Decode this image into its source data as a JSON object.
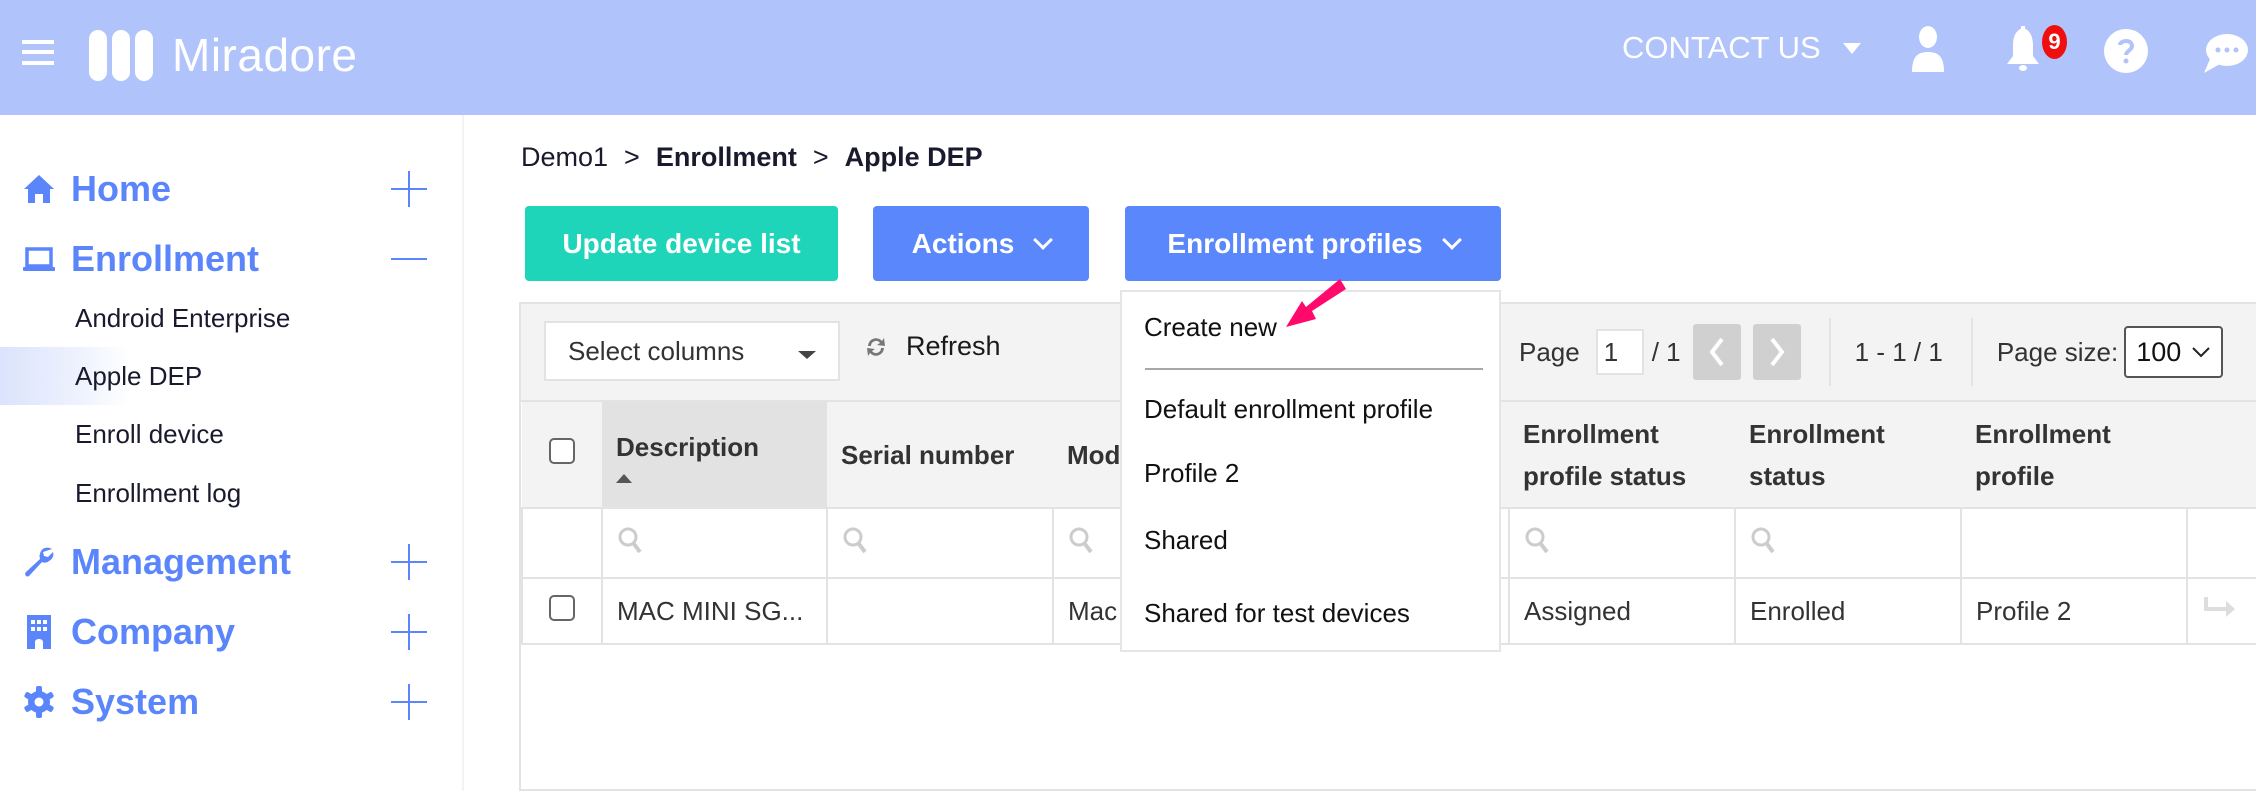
{
  "app": {
    "brand": "Miradore",
    "contact_label": "CONTACT US",
    "notification_count": "9",
    "colors": {
      "topbar": "#b0c3fa",
      "accent": "#5a85fb",
      "primary_button": "#5a87fb",
      "success_button": "#1ed5b9",
      "badge": "#ef0f0f",
      "annotation_arrow": "#ff0a6c"
    },
    "icons": {
      "menu": "hamburger-icon",
      "user": "user-icon",
      "notifications": "bell-icon",
      "help": "question-icon",
      "chat": "chat-bubble-icon"
    }
  },
  "sidebar": {
    "items": [
      {
        "label": "Home",
        "icon": "home-icon",
        "toggle": "+"
      },
      {
        "label": "Enrollment",
        "icon": "laptop-icon",
        "toggle": "-",
        "expanded": true,
        "children": [
          {
            "label": "Android Enterprise"
          },
          {
            "label": "Apple DEP",
            "active": true
          },
          {
            "label": "Enroll device"
          },
          {
            "label": "Enrollment log"
          }
        ]
      },
      {
        "label": "Management",
        "icon": "wrench-icon",
        "toggle": "+"
      },
      {
        "label": "Company",
        "icon": "building-icon",
        "toggle": "+"
      },
      {
        "label": "System",
        "icon": "gear-icon",
        "toggle": "+"
      }
    ]
  },
  "breadcrumb": {
    "items": [
      "Demo1",
      "Enrollment",
      "Apple DEP"
    ],
    "separator": ">"
  },
  "actions": {
    "update_label": "Update device list",
    "actions_label": "Actions",
    "profiles_label": "Enrollment profiles"
  },
  "toolbar": {
    "select_columns": "Select columns",
    "refresh": "Refresh",
    "page_label": "Page",
    "page_value": "1",
    "page_total": "/ 1",
    "range": "1 - 1 / 1",
    "page_size_label": "Page size:",
    "page_size_value": "100"
  },
  "table": {
    "columns": [
      "Description",
      "Serial number",
      "Model",
      "Enrollment profile status",
      "Enrollment status",
      "Enrollment profile"
    ],
    "column_display": {
      "model_truncated": "Mod",
      "eps_line1": "Enrollment",
      "eps_line2": "profile status",
      "es_line1": "Enrollment",
      "es_line2": "status",
      "ep_line1": "Enrollment",
      "ep_line2": "profile"
    },
    "sorted_column": "Description",
    "sort_direction": "ascending",
    "rows": [
      {
        "description": "MAC MINI SG...",
        "serial_number": "",
        "model": "Mac",
        "enrollment_profile_status": "Assigned",
        "enrollment_status": "Enrolled",
        "enrollment_profile": "Profile 2"
      }
    ]
  },
  "profiles_menu": {
    "create_new": "Create new",
    "items": [
      "Default enrollment profile",
      "Profile 2",
      "Shared",
      "Shared for test devices"
    ]
  }
}
